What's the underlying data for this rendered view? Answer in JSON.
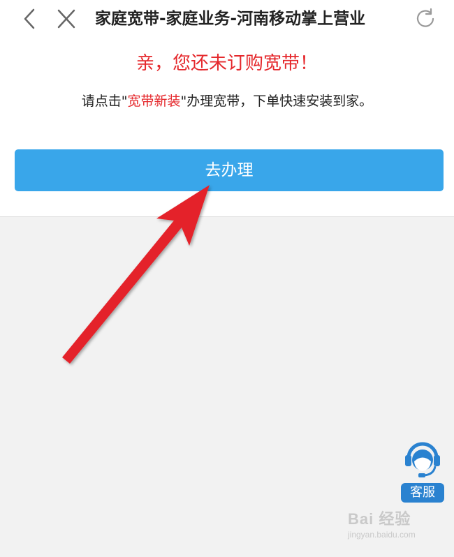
{
  "nav": {
    "title": "家庭宽带-家庭业务-河南移动掌上营业",
    "back_icon": "chevron-left-icon",
    "close_icon": "close-icon",
    "refresh_icon": "refresh-icon"
  },
  "content": {
    "notice": "亲，您还未订购宽带！",
    "instruction_prefix": "请点击\"",
    "instruction_highlight": "宽带新装",
    "instruction_suffix": "\"办理宽带，下单快速安装到家。",
    "cta_label": "去办理"
  },
  "service": {
    "label": "客服",
    "icon": "customer-service-icon"
  },
  "watermark": {
    "main": "Bai 经验",
    "sub": "jingyan.baidu.com"
  },
  "annotation": {
    "icon": "red-arrow-icon"
  },
  "colors": {
    "accent_button": "#39a6ea",
    "notice_red": "#e5282c",
    "service_blue": "#2a82d0",
    "arrow_red": "#e4232b"
  }
}
